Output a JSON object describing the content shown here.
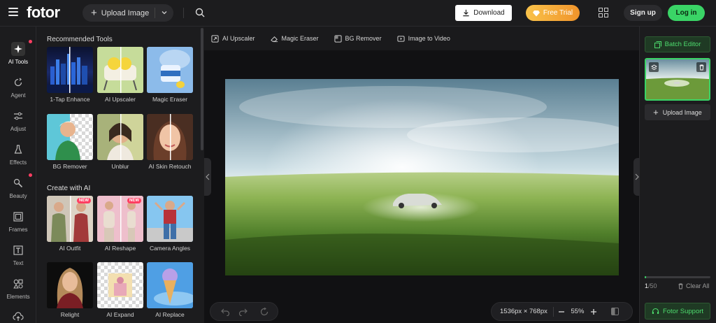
{
  "header": {
    "logo": "fotor",
    "upload_label": "Upload Image",
    "download_label": "Download",
    "trial_label": "Free Trial",
    "signup_label": "Sign up",
    "login_label": "Log in"
  },
  "rail": {
    "items": [
      {
        "label": "AI Tools",
        "icon": "sparkle-icon"
      },
      {
        "label": "Agent",
        "icon": "agent-icon"
      },
      {
        "label": "Adjust",
        "icon": "sliders-icon"
      },
      {
        "label": "Effects",
        "icon": "flask-icon"
      },
      {
        "label": "Beauty",
        "icon": "beauty-icon"
      },
      {
        "label": "Frames",
        "icon": "frame-icon"
      },
      {
        "label": "Text",
        "icon": "text-icon"
      },
      {
        "label": "Elements",
        "icon": "elements-icon"
      }
    ]
  },
  "tools": {
    "recommended_title": "Recommended Tools",
    "create_title": "Create with AI",
    "recommended": [
      "1-Tap Enhance",
      "AI Upscaler",
      "Magic Eraser",
      "BG Remover",
      "Unblur",
      "AI Skin Retouch"
    ],
    "create": [
      "AI Outfit",
      "AI Reshape",
      "Camera Angles",
      "Relight",
      "AI Expand",
      "AI Replace"
    ],
    "new_badge": "NEW"
  },
  "quickbar": {
    "items": [
      "AI Upscaler",
      "Magic Eraser",
      "BG Remover",
      "Image to Video"
    ]
  },
  "canvas": {
    "size_label": "1536px × 768px",
    "zoom_label": "55%"
  },
  "rightpanel": {
    "batch_label": "Batch Editor",
    "upload_label": "Upload Image",
    "count": "1",
    "count_max": "/50",
    "progress_fraction": 0.02,
    "clear_label": "Clear All",
    "support_label": "Fotor Support"
  },
  "colors": {
    "accent_green": "#3ad466",
    "trial_orange": "#f0942b",
    "notify_red": "#ff3e62"
  }
}
